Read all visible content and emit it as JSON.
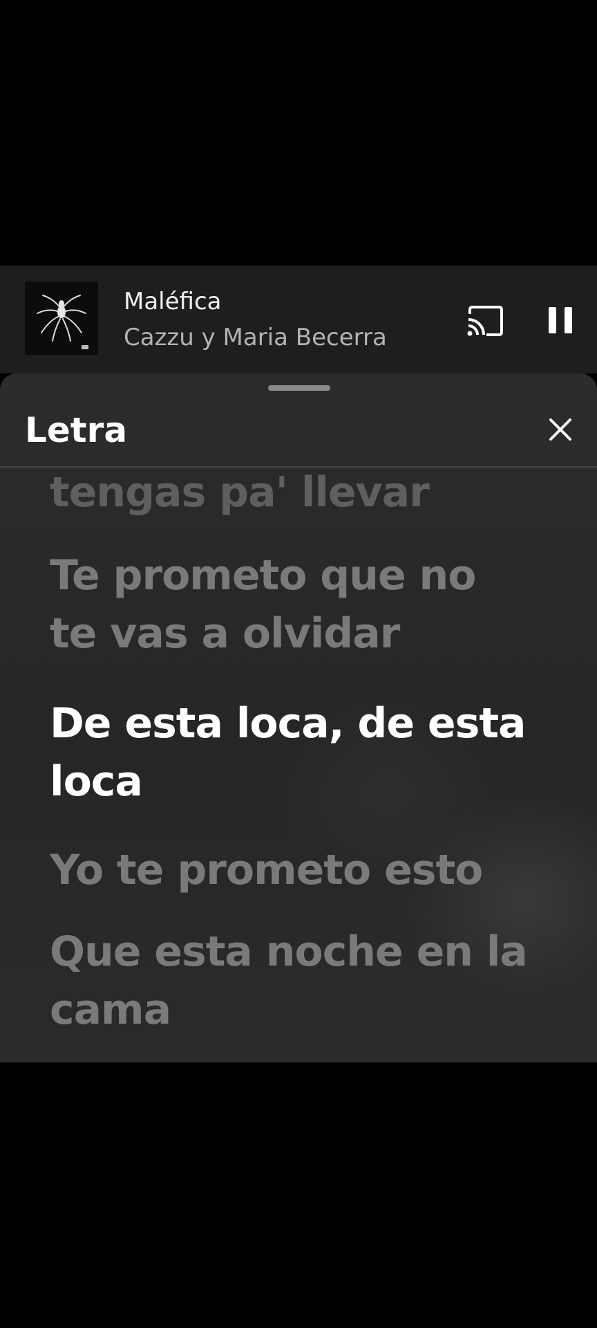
{
  "mini_player": {
    "title": "Maléfica",
    "artist": "Cazzu y Maria Becerra",
    "album_art": "spider-album-art",
    "cast_icon": "cast-icon",
    "pause_icon": "pause-icon"
  },
  "lyrics_sheet": {
    "title": "Letra",
    "close_icon": "close-icon",
    "lines": [
      {
        "text": [
          "tengas pa' llevar"
        ],
        "state": "partial"
      },
      {
        "text": [
          "Te prometo que no",
          "te vas a olvidar"
        ],
        "state": "inactive"
      },
      {
        "text": [
          "De esta loca, de esta",
          "loca"
        ],
        "state": "active"
      },
      {
        "text": [
          "Yo te prometo esto"
        ],
        "state": "inactive"
      },
      {
        "text": [
          "Que esta noche en la",
          "cama"
        ],
        "state": "inactive"
      }
    ]
  },
  "colors": {
    "background": "#000000",
    "mini_player_bg": "#1e1e1e",
    "sheet_bg": "#2a2a2a",
    "active_lyric": "#ffffff",
    "inactive_lyric": "#7a7a7a",
    "artist_text": "#b3b3b3"
  }
}
